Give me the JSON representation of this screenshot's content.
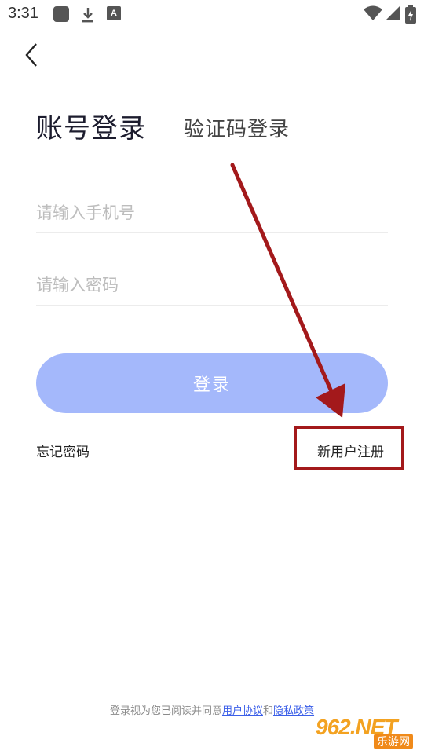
{
  "status_bar": {
    "time": "3:31",
    "a_icon_label": "A"
  },
  "tabs": {
    "account_login": "账号登录",
    "code_login": "验证码登录"
  },
  "form": {
    "phone_placeholder": "请输入手机号",
    "password_placeholder": "请输入密码",
    "login_label": "登录"
  },
  "links": {
    "forgot_password": "忘记密码",
    "register": "新用户注册"
  },
  "agreement": {
    "prefix": "登录视为您已阅读并同意",
    "user_agreement": "用户协议",
    "and": "和",
    "privacy_policy": "隐私政策"
  },
  "watermark": {
    "main": "962.NET",
    "sub": "乐游网"
  },
  "colors": {
    "login_button": "#a4b8fb",
    "annotation_red": "#a3191b",
    "link_blue": "#3a5ee8",
    "watermark_orange": "#f3a221"
  },
  "icons": [
    "square-notification-icon",
    "download-icon",
    "a-icon",
    "wifi-icon",
    "signal-icon",
    "battery-icon",
    "back-arrow-icon"
  ]
}
